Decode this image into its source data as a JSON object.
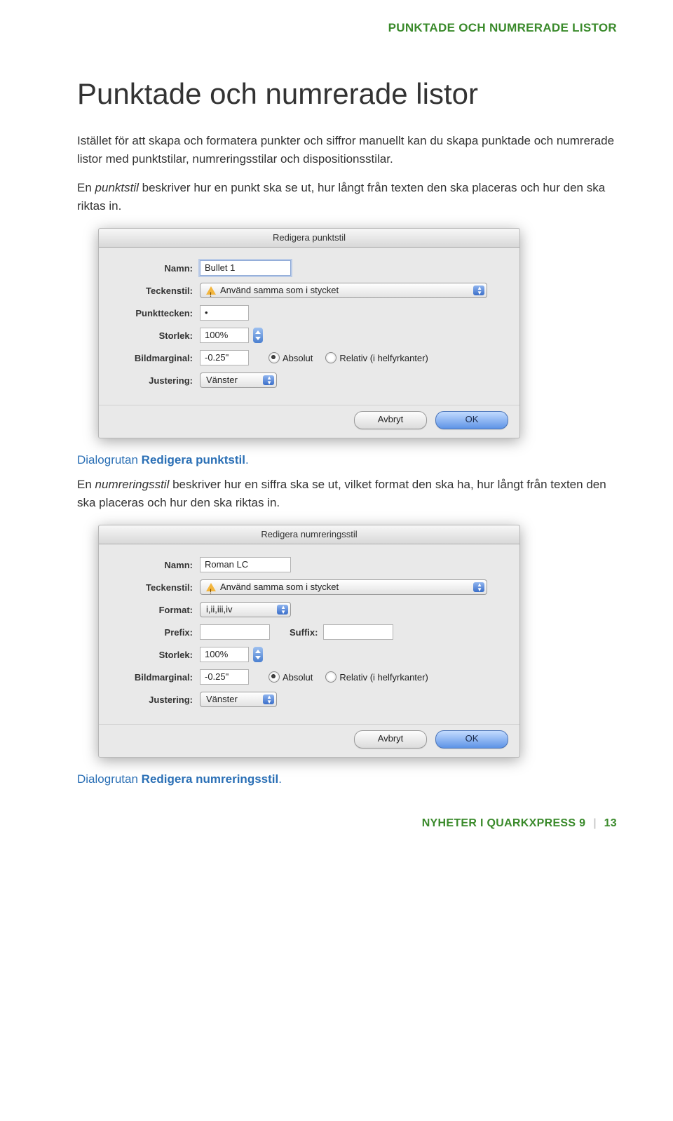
{
  "header": "PUNKTADE OCH NUMRERADE LISTOR",
  "title": "Punktade och numrerade listor",
  "p1": "Istället för att skapa och formatera punkter och siffror manuellt kan du skapa punktade och numrerade listor med punktstilar, numreringsstilar och dispositionsstilar.",
  "p2a": "En ",
  "p2_em": "punktstil",
  "p2b": " beskriver hur en punkt ska se ut, hur långt från texten den ska placeras och hur den ska riktas in.",
  "caption1a": "Dialogrutan ",
  "caption1b": "Redigera punktstil",
  "caption1c": ".",
  "p3a": "En ",
  "p3_em": "numreringsstil",
  "p3b": " beskriver hur en siffra ska se ut, vilket format den ska ha, hur långt från texten den ska placeras och hur den ska riktas in.",
  "caption2a": "Dialogrutan ",
  "caption2b": "Redigera numreringsstil",
  "caption2c": ".",
  "footer": {
    "text": "NYHETER I QUARKXPRESS 9",
    "page": "13"
  },
  "dialog1": {
    "title": "Redigera punktstil",
    "labels": {
      "name": "Namn:",
      "charstyle": "Teckenstil:",
      "bulletchar": "Punkttecken:",
      "size": "Storlek:",
      "outset": "Bildmarginal:",
      "align": "Justering:"
    },
    "values": {
      "name": "Bullet 1",
      "charstyle": "Använd samma som i stycket",
      "bulletchar": "•",
      "size": "100%",
      "outset": "-0.25\"",
      "align": "Vänster"
    },
    "radios": {
      "absolute": "Absolut",
      "relative": "Relativ (i helfyrkanter)"
    },
    "buttons": {
      "cancel": "Avbryt",
      "ok": "OK"
    }
  },
  "dialog2": {
    "title": "Redigera numreringsstil",
    "labels": {
      "name": "Namn:",
      "charstyle": "Teckenstil:",
      "format": "Format:",
      "prefix": "Prefix:",
      "suffix": "Suffix:",
      "size": "Storlek:",
      "outset": "Bildmarginal:",
      "align": "Justering:"
    },
    "values": {
      "name": "Roman LC",
      "charstyle": "Använd samma som i stycket",
      "format": "i,ii,iii,iv",
      "prefix": "",
      "suffix": "",
      "size": "100%",
      "outset": "-0.25\"",
      "align": "Vänster"
    },
    "radios": {
      "absolute": "Absolut",
      "relative": "Relativ (i helfyrkanter)"
    },
    "buttons": {
      "cancel": "Avbryt",
      "ok": "OK"
    }
  }
}
